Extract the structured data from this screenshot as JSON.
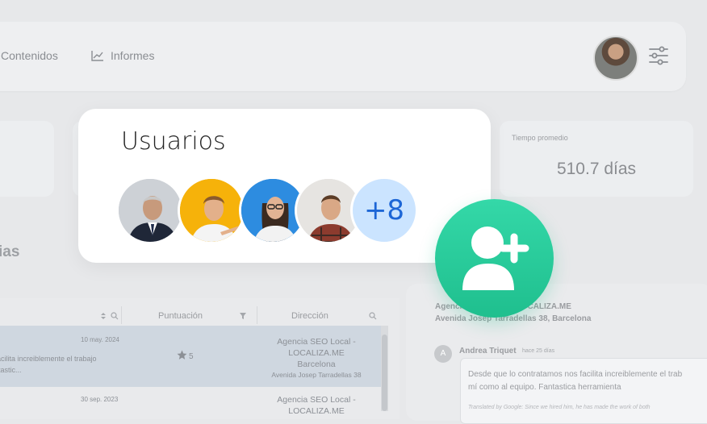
{
  "nav": {
    "contenidos": "Contenidos",
    "informes": "Informes"
  },
  "stats": {
    "tiempo_label": "Tiempo promedio",
    "tiempo_value": "510.7 días"
  },
  "section_heading": "ias",
  "table": {
    "headers": {
      "puntuacion": "Puntuación",
      "direccion": "Dirección"
    },
    "rows": [
      {
        "date": "10 may. 2024",
        "text_line1": "acilita increiblemente el trabajo",
        "text_line2": "tastic...",
        "score": "5",
        "addr_line1": "Agencia SEO Local -",
        "addr_line2": "LOCALIZA.ME",
        "addr_line3": "Barcelona",
        "addr_line4": "Avenida Josep Tarradellas 38"
      },
      {
        "date": "30 sep. 2023",
        "addr_line1": "Agencia SEO Local -",
        "addr_line2": "LOCALIZA.ME"
      }
    ]
  },
  "review_panel": {
    "business_line1": "Agencia SEO Local - LOCALIZA.ME",
    "business_line2": "Avenida Josep Tarradellas 38, Barcelona",
    "author_initial": "A",
    "author": "Andrea Triquet",
    "time_ago": "hace 25 días",
    "review_line1": "Desde que lo contratamos nos facilita increiblemente el trab",
    "review_line2": "mí como al equipo. Fantastica herramienta",
    "translated": "Translated by Google: Since we hired him, he has made the work of both"
  },
  "users_card": {
    "title": "Usuarios",
    "more_count": "+8"
  },
  "colors": {
    "accent_green": "#24c995",
    "more_bg": "#cbe4ff",
    "more_text": "#1d66d6"
  },
  "icons": {
    "informes": "line-chart-icon",
    "settings": "sliders-icon",
    "add_user": "user-plus-icon",
    "star": "star-icon"
  }
}
